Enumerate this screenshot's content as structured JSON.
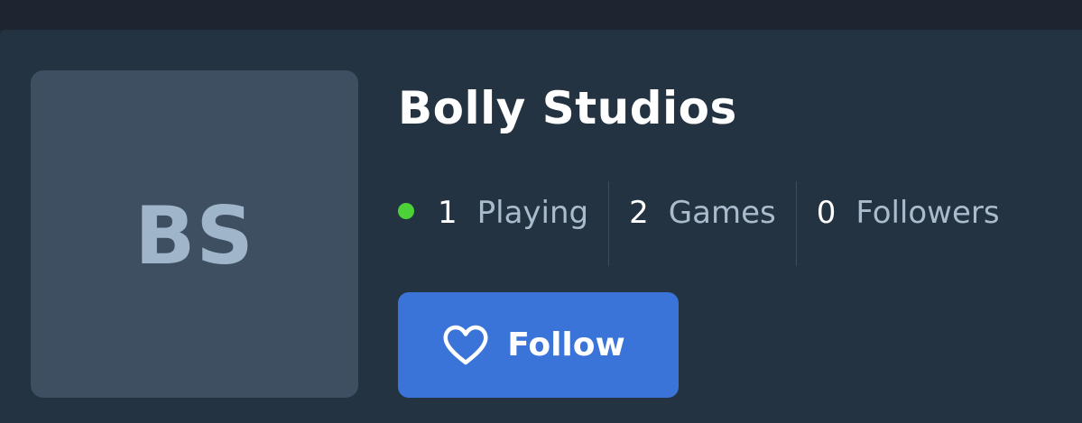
{
  "profile": {
    "initials": "BS",
    "name": "Bolly Studios"
  },
  "stats": {
    "playing": {
      "value": "1",
      "label": "Playing"
    },
    "games": {
      "value": "2",
      "label": "Games"
    },
    "followers": {
      "value": "0",
      "label": "Followers"
    }
  },
  "actions": {
    "follow_label": "Follow",
    "follow_icon": "heart-icon"
  },
  "colors": {
    "online": "#4cd137",
    "accent": "#3a74d8",
    "background": "#243341",
    "avatar_bg": "#3e4f61"
  }
}
